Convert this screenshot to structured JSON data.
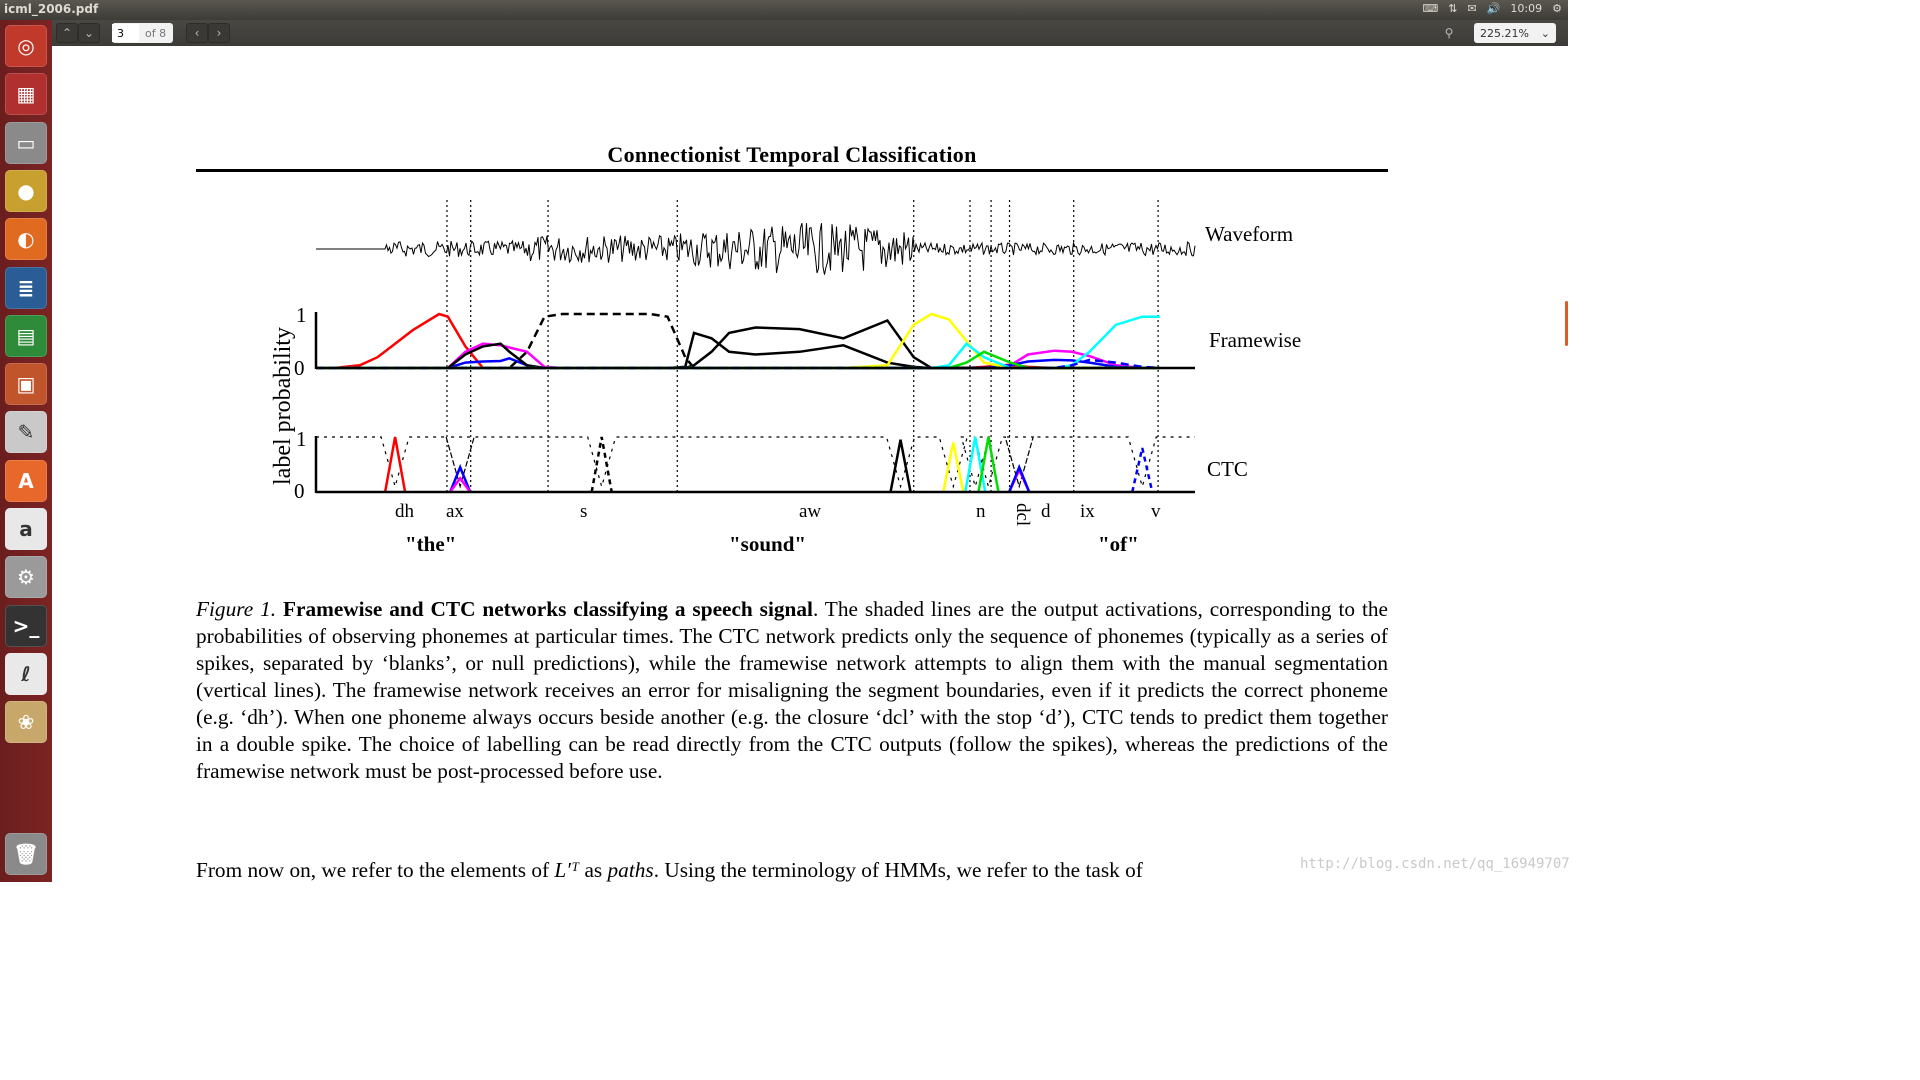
{
  "window": {
    "title": "icml_2006.pdf",
    "clock": "10:09"
  },
  "toolbar": {
    "prev_page_icon": "chevron-up-icon",
    "next_page_icon": "chevron-down-icon",
    "page_current": "3",
    "page_total_label": "of 8",
    "back_icon": "chevron-left-icon",
    "forward_icon": "chevron-right-icon",
    "search_icon": "search-icon",
    "zoom_level": "225.21%"
  },
  "tray": {
    "icons": [
      "keyboard-icon",
      "network-icon",
      "mail-icon",
      "volume-icon",
      "gear-icon"
    ]
  },
  "launcher": {
    "items": [
      {
        "name": "ubuntu-dash",
        "color": "#c0392b",
        "glyph": "◎"
      },
      {
        "name": "workspace-switcher",
        "color": "#b03030",
        "glyph": "▦"
      },
      {
        "name": "files",
        "color": "#8a8a8a",
        "glyph": "▭"
      },
      {
        "name": "chrome",
        "color": "#c8a030",
        "glyph": "●"
      },
      {
        "name": "firefox",
        "color": "#e06a20",
        "glyph": "◐"
      },
      {
        "name": "libreoffice-writer",
        "color": "#2a5d96",
        "glyph": "≣"
      },
      {
        "name": "libreoffice-calc",
        "color": "#2e8b3a",
        "glyph": "▤"
      },
      {
        "name": "libreoffice-impress",
        "color": "#c0542a",
        "glyph": "▣"
      },
      {
        "name": "text-editor",
        "color": "#c9c9c9",
        "glyph": "✎"
      },
      {
        "name": "software-center",
        "color": "#e8672a",
        "glyph": "A"
      },
      {
        "name": "amazon",
        "color": "#e8e8e8",
        "glyph": "a"
      },
      {
        "name": "system-settings",
        "color": "#9a9a9a",
        "glyph": "⚙"
      },
      {
        "name": "terminal",
        "color": "#333333",
        "glyph": ">_"
      },
      {
        "name": "document-viewer",
        "color": "#e9e9e9",
        "glyph": "ℓ"
      },
      {
        "name": "image-viewer",
        "color": "#c8a86a",
        "glyph": "❀"
      },
      {
        "name": "trash",
        "color": "#8a8a8a",
        "glyph": "🗑"
      }
    ]
  },
  "page": {
    "running_header": "Connectionist Temporal Classification",
    "figure": {
      "row_labels": {
        "waveform": "Waveform",
        "framewise": "Framewise",
        "ctc": "CTC"
      },
      "ylabel": "label probability",
      "yticks": [
        "0",
        "1"
      ],
      "phonemes": [
        "dh",
        "ax",
        "s",
        "aw",
        "n",
        "dcl",
        "d",
        "ix",
        "v"
      ],
      "words": [
        "\"the\"",
        "\"sound\"",
        "\"of\""
      ]
    },
    "caption": {
      "label": "Figure 1.",
      "bold": "Framewise and CTC networks classifying a speech signal",
      "text": ". The shaded lines are the output activations, corresponding to the probabilities of observing phonemes at particular times.  The CTC network predicts only the sequence of phonemes (typically as a series of spikes, separated by ‘blanks’, or null predictions), while the framewise network attempts to align them with the manual segmentation (vertical lines). The framewise network receives an error for misaligning the segment boundaries, even if it predicts the correct phoneme (e.g. ‘dh’). When one phoneme always occurs beside another (e.g. the closure ‘dcl’ with the stop ‘d’), CTC tends to predict them together in a double spike. The choice of labelling can be read directly from the CTC outputs (follow the spikes), whereas the predictions of the framewise network must be post-processed before use."
    },
    "body_start": {
      "pre": "From now on, we refer to the elements of ",
      "math": "L′ᵀ",
      "mid": " as ",
      "em": "paths",
      "post": ".      Using the terminology of HMMs, we refer to the task of"
    },
    "watermark": "http://blog.csdn.net/qq_16949707"
  },
  "chart_data": {
    "type": "line",
    "title": "",
    "ylabel": "label probability",
    "ylim": [
      0,
      1
    ],
    "x_segment_boundaries": [
      0.149,
      0.176,
      0.264,
      0.411,
      0.68,
      0.744,
      0.768,
      0.789,
      0.862,
      0.958
    ],
    "phoneme_segments": [
      "dh",
      "ax",
      "s",
      "aw",
      "n",
      "dcl",
      "d",
      "ix",
      "v"
    ],
    "words": [
      "\"the\"",
      "\"sound\"",
      "\"of\""
    ],
    "framewise": {
      "x": [
        0.0,
        0.02,
        0.05,
        0.07,
        0.11,
        0.14,
        0.15,
        0.17,
        0.19,
        0.21,
        0.22,
        0.24,
        0.26,
        0.28,
        0.3,
        0.32,
        0.35,
        0.38,
        0.4,
        0.42,
        0.43,
        0.45,
        0.47,
        0.5,
        0.55,
        0.6,
        0.65,
        0.68,
        0.7,
        0.72,
        0.74,
        0.76,
        0.79,
        0.81,
        0.84,
        0.86,
        0.88,
        0.91,
        0.94,
        0.96
      ],
      "series": [
        {
          "name": "dh (red)",
          "color": "#ff0000",
          "values": [
            0,
            0,
            0.05,
            0.2,
            0.7,
            1,
            0.95,
            0.4,
            0,
            0,
            0,
            0,
            0,
            0,
            0,
            0,
            0,
            0,
            0,
            0,
            0,
            0,
            0,
            0,
            0,
            0,
            0,
            0,
            0,
            0,
            0,
            0.02,
            0.06,
            0.02,
            0,
            0,
            0,
            0,
            0,
            0
          ]
        },
        {
          "name": "ax (magenta)",
          "color": "#ff00ff",
          "values": [
            0,
            0,
            0,
            0,
            0,
            0,
            0,
            0.3,
            0.45,
            0.42,
            0.38,
            0.3,
            0.02,
            0,
            0,
            0,
            0,
            0,
            0,
            0,
            0,
            0,
            0,
            0,
            0,
            0,
            0,
            0,
            0,
            0,
            0,
            0,
            0.05,
            0.25,
            0.32,
            0.3,
            0.22,
            0.05,
            0,
            0
          ]
        },
        {
          "name": "ax-blue",
          "color": "#0000ff",
          "values": [
            0,
            0,
            0,
            0,
            0,
            0,
            0,
            0.1,
            0.12,
            0.13,
            0.18,
            0.05,
            0,
            0,
            0,
            0,
            0,
            0,
            0,
            0,
            0,
            0,
            0,
            0,
            0,
            0,
            0,
            0,
            0,
            0,
            0,
            0,
            0.05,
            0.12,
            0.15,
            0.14,
            0.1,
            0.02,
            0,
            0
          ]
        },
        {
          "name": "s (dashed)",
          "color": "#000000",
          "dash": true,
          "values": [
            0,
            0,
            0,
            0,
            0,
            0,
            0,
            0,
            0,
            0,
            0,
            0.3,
            0.95,
            1,
            1,
            1,
            1,
            1,
            0.95,
            0.2,
            0,
            0,
            0,
            0,
            0,
            0,
            0,
            0,
            0,
            0,
            0,
            0,
            0,
            0,
            0,
            0,
            0,
            0,
            0,
            0
          ]
        },
        {
          "name": "aw (thick)",
          "color": "#000000",
          "values": [
            0,
            0,
            0,
            0,
            0,
            0,
            0,
            0,
            0,
            0,
            0,
            0,
            0,
            0,
            0,
            0,
            0,
            0,
            0,
            0,
            0.05,
            0.3,
            0.65,
            0.75,
            0.72,
            0.55,
            0.88,
            0.2,
            0,
            0,
            0,
            0,
            0,
            0,
            0,
            0,
            0,
            0,
            0,
            0
          ]
        },
        {
          "name": "aw-alt (thin)",
          "color": "#000000",
          "values": [
            0,
            0,
            0,
            0,
            0,
            0,
            0,
            0.25,
            0.4,
            0.45,
            0.3,
            0.05,
            0,
            0,
            0,
            0,
            0,
            0,
            0,
            0.02,
            0.65,
            0.55,
            0.3,
            0.25,
            0.3,
            0.42,
            0.1,
            0.02,
            0,
            0,
            0,
            0,
            0,
            0,
            0,
            0,
            0,
            0,
            0,
            0
          ]
        },
        {
          "name": "n (yellow)",
          "color": "#ffff00",
          "values": [
            0,
            0,
            0,
            0,
            0,
            0,
            0,
            0,
            0,
            0,
            0,
            0,
            0,
            0,
            0,
            0,
            0,
            0,
            0,
            0,
            0,
            0,
            0,
            0,
            0,
            0,
            0.05,
            0.8,
            1,
            0.9,
            0.5,
            0.1,
            0,
            0,
            0,
            0,
            0,
            0,
            0,
            0
          ]
        },
        {
          "name": "dcl (cyan)",
          "color": "#00ffff",
          "values": [
            0,
            0,
            0,
            0,
            0,
            0,
            0,
            0,
            0,
            0,
            0,
            0,
            0,
            0,
            0,
            0,
            0,
            0,
            0,
            0,
            0,
            0,
            0,
            0,
            0,
            0,
            0,
            0,
            0,
            0.05,
            0.45,
            0.2,
            0,
            0,
            0,
            0.05,
            0.3,
            0.8,
            0.95,
            0.95
          ]
        },
        {
          "name": "d (green)",
          "color": "#00dd00",
          "values": [
            0,
            0,
            0,
            0,
            0,
            0,
            0,
            0,
            0,
            0,
            0,
            0,
            0,
            0,
            0,
            0,
            0,
            0,
            0,
            0,
            0,
            0,
            0,
            0,
            0,
            0,
            0,
            0,
            0,
            0,
            0.1,
            0.3,
            0.1,
            0,
            0,
            0,
            0,
            0,
            0,
            0
          ]
        },
        {
          "name": "v (blue dashed)",
          "color": "#0000ff",
          "dash": true,
          "values": [
            0,
            0,
            0,
            0,
            0,
            0,
            0,
            0,
            0,
            0,
            0,
            0,
            0,
            0,
            0,
            0,
            0,
            0,
            0,
            0,
            0,
            0,
            0,
            0,
            0,
            0,
            0,
            0,
            0,
            0,
            0,
            0,
            0,
            0,
            0,
            0.05,
            0.15,
            0.1,
            0.02,
            0
          ]
        }
      ]
    },
    "ctc": {
      "blank_note": "dotted line = blank probability, near 1 between spikes",
      "spikes": [
        {
          "label": "dh",
          "color": "#ff0000",
          "x": 0.09,
          "value": 1.0
        },
        {
          "label": "ax",
          "color": "#0000ff",
          "x": 0.164,
          "value": 0.45
        },
        {
          "label": "ax",
          "color": "#ff00ff",
          "x": 0.164,
          "value": 0.25
        },
        {
          "label": "s",
          "color": "#000000",
          "dash": true,
          "x": 0.325,
          "value": 1.0
        },
        {
          "label": "aw",
          "color": "#000000",
          "x": 0.665,
          "value": 0.95
        },
        {
          "label": "n",
          "color": "#ffff00",
          "x": 0.725,
          "value": 0.9
        },
        {
          "label": "dcl",
          "color": "#00ffff",
          "x": 0.75,
          "value": 1.0
        },
        {
          "label": "d",
          "color": "#00dd00",
          "x": 0.765,
          "value": 1.0
        },
        {
          "label": "ix",
          "color": "#ff00ff",
          "x": 0.8,
          "value": 0.4
        },
        {
          "label": "ix",
          "color": "#0000ff",
          "x": 0.8,
          "value": 0.45
        },
        {
          "label": "v",
          "color": "#0000ff",
          "dash": true,
          "x": 0.94,
          "value": 0.8
        }
      ]
    }
  }
}
